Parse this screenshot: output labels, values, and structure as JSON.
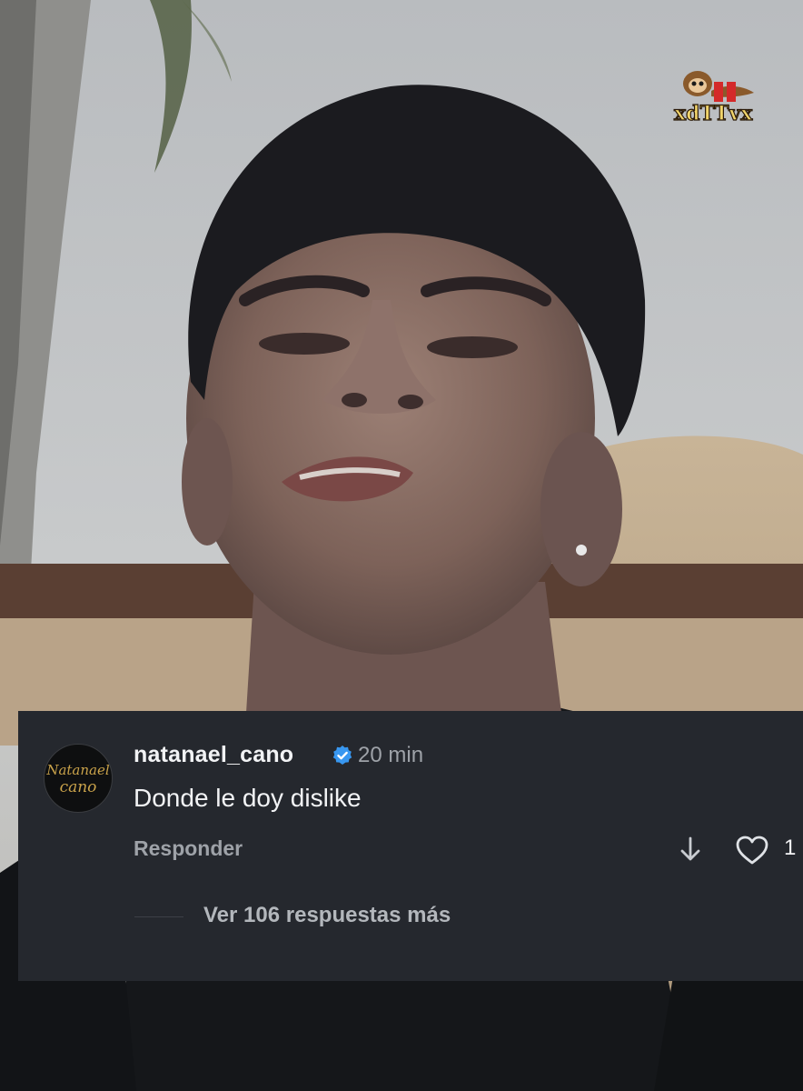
{
  "comment": {
    "username": "natanael_cano",
    "time": "20 min",
    "text": "Donde le doy dislike",
    "reply_label": "Responder",
    "like_count": "1",
    "view_replies": "Ver 106 respuestas más",
    "avatar_text": "Natanael Cano"
  },
  "watermark": {
    "text": "xdTTvx"
  },
  "icons": {
    "verified": "verified-badge-icon",
    "dislike": "arrow-down-icon",
    "like": "heart-outline-icon"
  },
  "colors": {
    "card_bg": "#25282e",
    "verified_blue": "#3897f0",
    "text_primary": "#f2f3f5",
    "text_secondary": "#9ea2a8"
  }
}
